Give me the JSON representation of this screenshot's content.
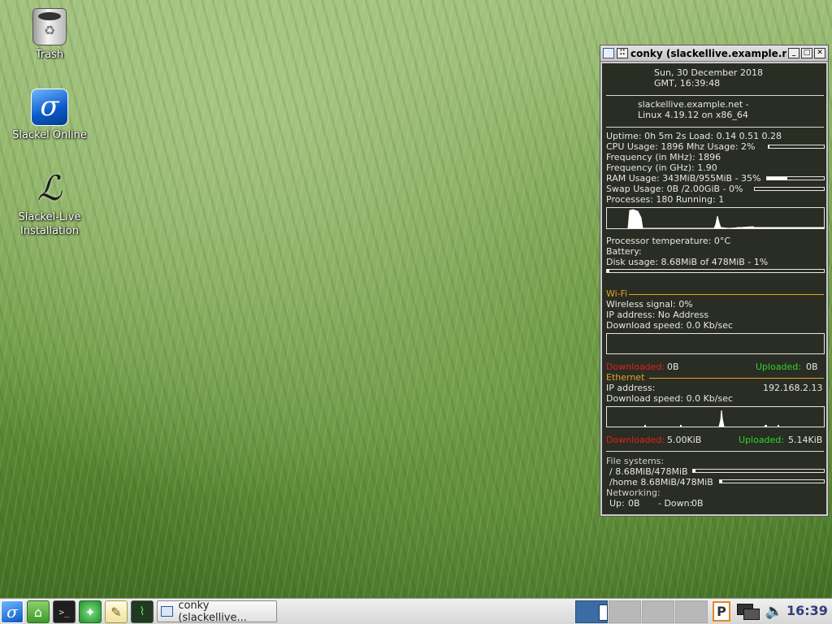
{
  "desktop": {
    "icons": [
      {
        "label": "Trash",
        "icon": "trash-icon"
      },
      {
        "label": "Slackel Online",
        "icon": "slackel-online-icon"
      },
      {
        "label_line1": "Slackel-Live",
        "label_line2": "Installation",
        "icon": "slackel-live-installer-icon"
      }
    ]
  },
  "conky": {
    "window_title": "conky (slackellive.example.net)",
    "date_line1": "Sun,  30 December 2018",
    "date_line2": "GMT,     16:39:48",
    "host_line1": "slackellive.example.net -",
    "host_line2": "Linux 4.19.12 on x86_64",
    "uptime": "Uptime: 0h 5m 2s Load:  0.14 0.51 0.28",
    "cpu_usage": "CPU Usage:  1896 Mhz  Usage: 2%",
    "cpu_usage_pct": 2,
    "freq_mhz": "Frequency (in MHz): 1896",
    "freq_ghz": "Frequency (in GHz): 1.90",
    "ram_usage": "RAM Usage: 343MiB/955MiB - 35%",
    "ram_usage_pct": 35,
    "swap_usage": "Swap Usage: 0B  /2.00GiB - 0%",
    "swap_usage_pct": 0,
    "processes": "Processes: 180  Running: 1",
    "proc_temp": "Processor temperature: 0°C",
    "battery": "Battery:",
    "disk_usage": "Disk usage: 8.68MiB of 478MiB - 1%",
    "disk_usage_pct": 1,
    "wifi_header": "Wi-Fi",
    "wifi_signal": "Wireless signal: 0%",
    "wifi_ip": "IP address: No Address",
    "wifi_download": "Download speed:  0.0 Kb/sec",
    "wifi_downloaded_label": "Downloaded:",
    "wifi_downloaded_value": "0B",
    "wifi_uploaded_label": "Uploaded:",
    "wifi_uploaded_value": "0B",
    "eth_header": "Ethernet",
    "eth_ip_label": "IP address:",
    "eth_ip_value": "192.168.2.13",
    "eth_download": "Download speed:  0.0 Kb/sec",
    "eth_downloaded_label": "Downloaded:",
    "eth_downloaded_value": "5.00KiB",
    "eth_uploaded_label": "Uploaded:",
    "eth_uploaded_value": "5.14KiB",
    "fs_header": "File systems:",
    "fs_root": "/ 8.68MiB/478MiB",
    "fs_root_pct": 2,
    "fs_home": "/home 8.68MiB/478MiB",
    "fs_home_pct": 2,
    "net_header": "Networking:",
    "net_up_label": "Up:",
    "net_up_value": "0B",
    "net_down_label": "- Down:",
    "net_down_value": "0B"
  },
  "taskbar": {
    "task_label": "conky (slackellive...",
    "clock": "16:39",
    "pager_indicator": "P",
    "launchers": [
      "slackel-menu-icon",
      "home-folder-icon",
      "terminal-icon",
      "web-browser-icon",
      "text-editor-icon",
      "system-monitor-icon"
    ]
  }
}
